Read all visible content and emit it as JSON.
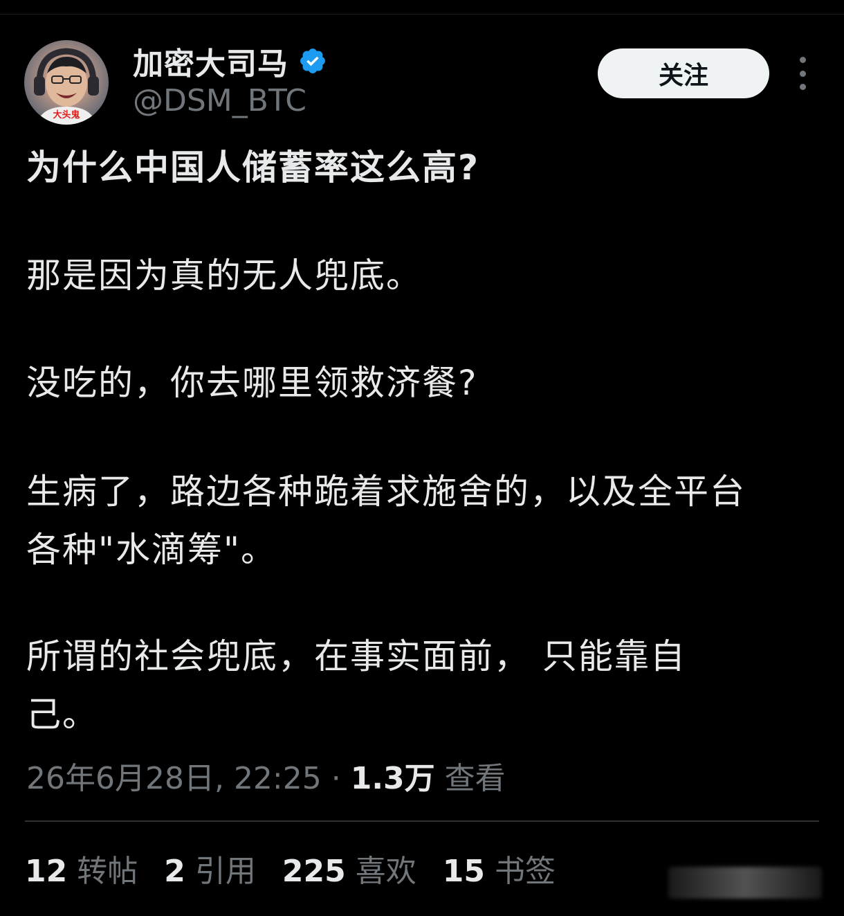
{
  "author": {
    "display_name": "加密大司马",
    "handle": "@DSM_BTC",
    "verified_color": "#1d9bf0",
    "avatar_icon": "avatar-photo",
    "avatar_badge_text": "大头鬼"
  },
  "header": {
    "follow_label": "关注",
    "more_icon": "more-vertical-icon"
  },
  "tweet": {
    "lines": [
      "为什么中国人储蓄率这么高?",
      "那是因为真的无人兜底。",
      "没吃的，你去哪里领救济餐?",
      "生病了，路边各种跪着求施舍的，以及全平台",
      "各种\"水滴筹\"。",
      "所谓的社会兜底，在事实面前， 只能靠自",
      "己。"
    ]
  },
  "meta": {
    "timestamp": "26年6月28日, 22:25",
    "separator": " · ",
    "views_count": "1.3万",
    "views_label": " 查看"
  },
  "stats": [
    {
      "num": "12",
      "label": "转帖"
    },
    {
      "num": "2",
      "label": "引用"
    },
    {
      "num": "225",
      "label": "喜欢"
    },
    {
      "num": "15",
      "label": "书签"
    }
  ],
  "colors": {
    "background": "#000000",
    "text": "#e7e9ea",
    "secondary": "#71767b",
    "divider": "#2f3336",
    "button_bg": "#eff3f4"
  }
}
